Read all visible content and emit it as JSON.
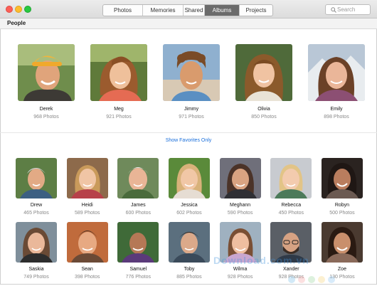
{
  "toolbar": {
    "tabs": [
      {
        "label": "Photos",
        "active": false
      },
      {
        "label": "Memories",
        "active": false
      },
      {
        "label": "Shared",
        "active": false
      },
      {
        "label": "Albums",
        "active": true
      },
      {
        "label": "Projects",
        "active": false
      }
    ],
    "search": {
      "placeholder": "Search"
    }
  },
  "section": {
    "title": "People"
  },
  "favorites": [
    {
      "name": "Derek",
      "count": "968 Photos",
      "icon": "portrait-photo"
    },
    {
      "name": "Meg",
      "count": "921 Photos",
      "icon": "portrait-photo"
    },
    {
      "name": "Jimmy",
      "count": "971 Photos",
      "icon": "portrait-photo"
    },
    {
      "name": "Olivia",
      "count": "850 Photos",
      "icon": "portrait-photo"
    },
    {
      "name": "Emily",
      "count": "898 Photos",
      "icon": "portrait-photo"
    }
  ],
  "show_favorites_label": "Show Favorites Only",
  "people_rows": [
    [
      {
        "name": "Drew",
        "count": "465 Photos"
      },
      {
        "name": "Heidi",
        "count": "589 Photos"
      },
      {
        "name": "James",
        "count": "600 Photos"
      },
      {
        "name": "Jessica",
        "count": "602 Photos"
      },
      {
        "name": "Meghann",
        "count": "590 Photos"
      },
      {
        "name": "Rebecca",
        "count": "450 Photos"
      },
      {
        "name": "Robyn",
        "count": "500 Photos"
      }
    ],
    [
      {
        "name": "Saskia",
        "count": "749 Photos"
      },
      {
        "name": "Sean",
        "count": "398 Photos"
      },
      {
        "name": "Samuel",
        "count": "776 Photos"
      },
      {
        "name": "Toby",
        "count": "885 Photos"
      },
      {
        "name": "Wilma",
        "count": "928 Photos"
      },
      {
        "name": "Xander",
        "count": "928 Photos"
      },
      {
        "name": "Zoe",
        "count": "130 Photos"
      }
    ]
  ],
  "watermark": "Download.com.vn",
  "colors": {
    "accent_link": "#1a6fdb",
    "active_tab": "#6b6b6b",
    "close": "#fc5f57",
    "minimize": "#fdbc2e",
    "zoom": "#28c840"
  }
}
